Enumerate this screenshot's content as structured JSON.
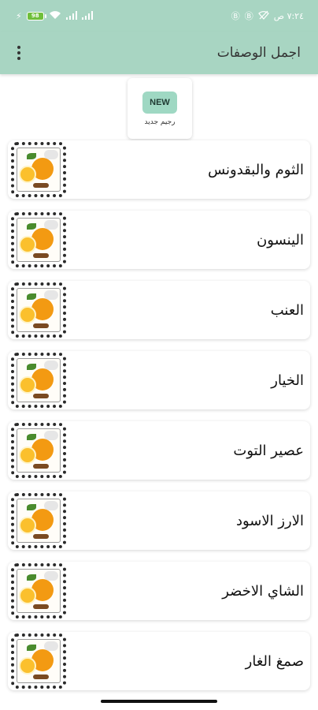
{
  "status_bar": {
    "battery": "98",
    "time": "٧:٢٤ ص",
    "icons": [
      "charging-icon",
      "battery-icon",
      "wifi-icon",
      "signal-icon",
      "signal-icon",
      "b-icon",
      "b-icon",
      "no-wifi-icon"
    ]
  },
  "app_bar": {
    "title": "اجمل الوصفات",
    "menu_icon": "more-vert-icon"
  },
  "new_button": {
    "badge": "NEW",
    "label": "رجيم جديد"
  },
  "recipes": [
    {
      "title": "الثوم والبقدونس"
    },
    {
      "title": "الينسون"
    },
    {
      "title": "العنب"
    },
    {
      "title": "الخيار"
    },
    {
      "title": "عصير التوت"
    },
    {
      "title": "الارز الاسود"
    },
    {
      "title": "الشاي الاخضر"
    },
    {
      "title": "صمغ الغار"
    }
  ],
  "colors": {
    "app_bar": "#a8d5c2",
    "badge": "#9fd8c3"
  }
}
